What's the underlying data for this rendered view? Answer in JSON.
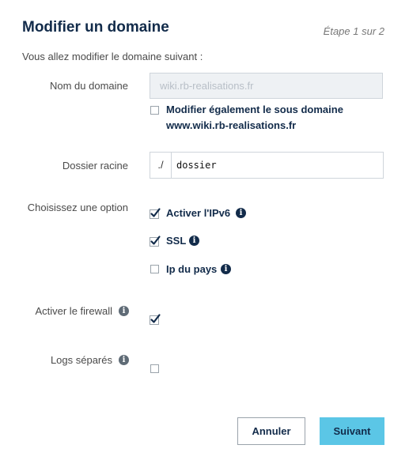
{
  "dialog": {
    "title": "Modifier un domaine",
    "step": "Étape 1 sur 2",
    "intro": "Vous allez modifier le domaine suivant :"
  },
  "domain": {
    "label": "Nom du domaine",
    "value": "wiki.rb-realisations.fr",
    "subdomain_option_line1": "Modifier également le sous domaine",
    "subdomain_option_line2": "www.wiki.rb-realisations.fr",
    "subdomain_checked": false
  },
  "root_folder": {
    "label": "Dossier racine",
    "prefix": "./",
    "value": "dossier"
  },
  "options": {
    "label": "Choisissez une option",
    "items": [
      {
        "label": "Activer l'IPv6",
        "checked": true
      },
      {
        "label": "SSL",
        "checked": true
      },
      {
        "label": "Ip du pays",
        "checked": false
      }
    ]
  },
  "firewall": {
    "label": "Activer le firewall",
    "checked": true
  },
  "logs": {
    "label": "Logs séparés",
    "checked": false
  },
  "buttons": {
    "cancel": "Annuler",
    "next": "Suivant"
  },
  "colors": {
    "title": "#122b4a",
    "primary_button": "#5bc6e6",
    "disabled_field": "#eef1f4"
  },
  "icons": {
    "info": "info-circle-icon",
    "check": "checkmark-icon"
  }
}
